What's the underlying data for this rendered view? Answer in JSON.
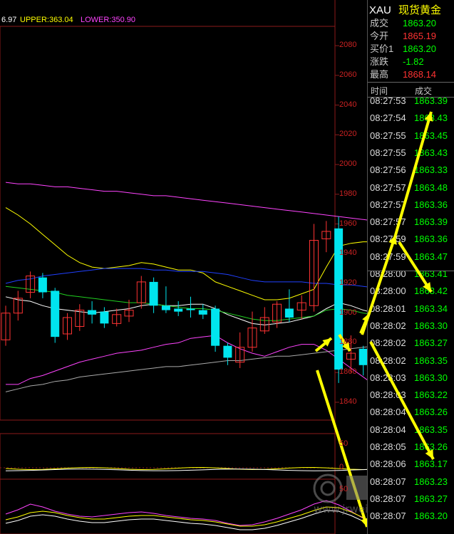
{
  "indicator": {
    "mid_label": "6.97",
    "upper_label": "UPPER:363.04",
    "lower_label": "LOWER:350.90",
    "colors": {
      "mid": "#ffffff",
      "upper": "#ffff00",
      "lower": "#ff44ff"
    }
  },
  "quote": {
    "symbol": "XAU",
    "name": "现货黄金",
    "rows": [
      {
        "label": "成交",
        "value": "1863.20",
        "color": "#00ff00"
      },
      {
        "label": "今开",
        "value": "1865.19",
        "color": "#ff3333"
      },
      {
        "label": "买价1",
        "value": "1863.20",
        "color": "#00ff00"
      },
      {
        "label": "涨跌",
        "value": "-1.82",
        "color": "#00ff00"
      },
      {
        "label": "最高",
        "value": "1868.14",
        "color": "#ff3333"
      }
    ],
    "tick_header": {
      "time": "时间",
      "price": "成交"
    },
    "ticks": [
      {
        "time": "08:27:53",
        "price": "1863.39"
      },
      {
        "time": "08:27:54",
        "price": "1863.43"
      },
      {
        "time": "08:27:55",
        "price": "1863.45"
      },
      {
        "time": "08:27:55",
        "price": "1863.43"
      },
      {
        "time": "08:27:56",
        "price": "1863.33"
      },
      {
        "time": "08:27:57",
        "price": "1863.48"
      },
      {
        "time": "08:27:57",
        "price": "1863.36"
      },
      {
        "time": "08:27:57",
        "price": "1863.39"
      },
      {
        "time": "08:27:59",
        "price": "1863.36"
      },
      {
        "time": "08:27:59",
        "price": "1863.47"
      },
      {
        "time": "08:28:00",
        "price": "1863.41"
      },
      {
        "time": "08:28:00",
        "price": "1863.42"
      },
      {
        "time": "08:28:01",
        "price": "1863.34"
      },
      {
        "time": "08:28:02",
        "price": "1863.30"
      },
      {
        "time": "08:28:02",
        "price": "1863.27"
      },
      {
        "time": "08:28:02",
        "price": "1863.35"
      },
      {
        "time": "08:28:03",
        "price": "1863.30"
      },
      {
        "time": "08:28:03",
        "price": "1863.22"
      },
      {
        "time": "08:28:04",
        "price": "1863.26"
      },
      {
        "time": "08:28:04",
        "price": "1863.35"
      },
      {
        "time": "08:28:05",
        "price": "1863.26"
      },
      {
        "time": "08:28:06",
        "price": "1863.17"
      },
      {
        "time": "08:28:07",
        "price": "1863.23"
      },
      {
        "time": "08:28:07",
        "price": "1863.27"
      },
      {
        "time": "08:28:07",
        "price": "1863.20"
      }
    ]
  },
  "chart_data": {
    "type": "candlestick",
    "y_ticks": [
      "2080",
      "2060",
      "2040",
      "2020",
      "2000",
      "1980",
      "1960",
      "1940",
      "1920",
      "1900",
      "1880",
      "1860",
      "1840"
    ],
    "ylim": [
      1828,
      2093
    ],
    "candles": [
      {
        "o": 1882,
        "c": 1900,
        "h": 1905,
        "l": 1878,
        "up": true
      },
      {
        "o": 1900,
        "c": 1910,
        "h": 1915,
        "l": 1895,
        "up": true
      },
      {
        "o": 1914,
        "c": 1925,
        "h": 1928,
        "l": 1910,
        "up": true
      },
      {
        "o": 1924,
        "c": 1914,
        "h": 1927,
        "l": 1910,
        "up": false
      },
      {
        "o": 1915,
        "c": 1884,
        "h": 1917,
        "l": 1880,
        "up": false
      },
      {
        "o": 1886,
        "c": 1897,
        "h": 1900,
        "l": 1882,
        "up": true
      },
      {
        "o": 1891,
        "c": 1902,
        "h": 1906,
        "l": 1888,
        "up": true
      },
      {
        "o": 1902,
        "c": 1899,
        "h": 1908,
        "l": 1893,
        "up": false
      },
      {
        "o": 1901,
        "c": 1893,
        "h": 1904,
        "l": 1890,
        "up": false
      },
      {
        "o": 1893,
        "c": 1899,
        "h": 1903,
        "l": 1891,
        "up": true
      },
      {
        "o": 1898,
        "c": 1902,
        "h": 1909,
        "l": 1894,
        "up": true
      },
      {
        "o": 1907,
        "c": 1921,
        "h": 1925,
        "l": 1903,
        "up": true
      },
      {
        "o": 1921,
        "c": 1905,
        "h": 1924,
        "l": 1900,
        "up": false
      },
      {
        "o": 1905,
        "c": 1902,
        "h": 1918,
        "l": 1900,
        "up": false
      },
      {
        "o": 1903,
        "c": 1901,
        "h": 1908,
        "l": 1898,
        "up": false
      },
      {
        "o": 1903,
        "c": 1902,
        "h": 1911,
        "l": 1897,
        "up": false
      },
      {
        "o": 1902,
        "c": 1899,
        "h": 1906,
        "l": 1896,
        "up": false
      },
      {
        "o": 1903,
        "c": 1878,
        "h": 1905,
        "l": 1874,
        "up": false
      },
      {
        "o": 1878,
        "c": 1870,
        "h": 1880,
        "l": 1865,
        "up": false
      },
      {
        "o": 1867,
        "c": 1877,
        "h": 1887,
        "l": 1863,
        "up": true
      },
      {
        "o": 1877,
        "c": 1890,
        "h": 1901,
        "l": 1874,
        "up": true
      },
      {
        "o": 1888,
        "c": 1897,
        "h": 1904,
        "l": 1886,
        "up": true
      },
      {
        "o": 1894,
        "c": 1906,
        "h": 1908,
        "l": 1890,
        "up": true
      },
      {
        "o": 1903,
        "c": 1897,
        "h": 1916,
        "l": 1894,
        "up": false
      },
      {
        "o": 1902,
        "c": 1907,
        "h": 1912,
        "l": 1896,
        "up": true
      },
      {
        "o": 1905,
        "c": 1949,
        "h": 1960,
        "l": 1901,
        "up": true
      },
      {
        "o": 1950,
        "c": 1955,
        "h": 1962,
        "l": 1941,
        "up": true
      },
      {
        "o": 1957,
        "c": 1862,
        "h": 1965,
        "l": 1853,
        "up": false
      },
      {
        "o": 1869,
        "c": 1873,
        "h": 1885,
        "l": 1860,
        "up": true
      },
      {
        "o": 1876,
        "c": 1865,
        "h": 1878,
        "l": 1858,
        "up": false
      },
      {
        "o": 1865,
        "c": 1863,
        "h": 1866,
        "l": 1862,
        "up": false
      }
    ],
    "lines": [
      {
        "name": "UPPER",
        "color": "#ffff00",
        "values": [
          1971,
          1966,
          1960,
          1953,
          1946,
          1939,
          1934,
          1931,
          1930,
          1931,
          1932,
          1934,
          1933,
          1931,
          1929,
          1929,
          1927,
          1921,
          1918,
          1915,
          1912,
          1909,
          1909,
          1910,
          1913,
          1916,
          1931,
          1945,
          1947,
          1948,
          1948
        ]
      },
      {
        "name": "MID",
        "color": "#ffffff",
        "values": [
          1911,
          1909,
          1908,
          1905,
          1903,
          1902,
          1901,
          1900,
          1901,
          1902,
          1903,
          1905,
          1906,
          1905,
          1905,
          1906,
          1906,
          1903,
          1899,
          1896,
          1893,
          1892,
          1893,
          1894,
          1896,
          1898,
          1903,
          1907,
          1905,
          1902,
          1900
        ]
      },
      {
        "name": "LOWER",
        "color": "#ff44ff",
        "values": [
          1852,
          1852,
          1856,
          1858,
          1861,
          1864,
          1867,
          1869,
          1871,
          1873,
          1874,
          1875,
          1877,
          1879,
          1880,
          1883,
          1884,
          1885,
          1880,
          1876,
          1873,
          1871,
          1874,
          1877,
          1879,
          1879,
          1875,
          1869,
          1863,
          1857,
          1851
        ]
      },
      {
        "name": "MA-blue",
        "color": "#2040ff",
        "values": [
          1920,
          1922,
          1923,
          1925,
          1926,
          1927,
          1928,
          1929,
          1930,
          1930,
          1930,
          1930,
          1929,
          1929,
          1928,
          1928,
          1928,
          1927,
          1926,
          1924,
          1922,
          1921,
          1921,
          1921,
          1921,
          1920,
          1920,
          1919,
          1919,
          1918,
          1917
        ]
      },
      {
        "name": "MA-green",
        "color": "#20d020",
        "values": [
          1918,
          1917,
          1916,
          1915,
          1914,
          1912,
          1911,
          1910,
          1909,
          1908,
          1907,
          1907,
          1906,
          1905,
          1904,
          1903,
          1903,
          1902,
          1900,
          1898,
          1896,
          1895,
          1895,
          1896,
          1897,
          1898,
          1902,
          1903,
          1902,
          1900,
          1899
        ]
      },
      {
        "name": "MA-magenta",
        "color": "#ff44ff",
        "values": [
          1988,
          1987,
          1987,
          1986,
          1985,
          1985,
          1984,
          1983,
          1982,
          1982,
          1981,
          1980,
          1979,
          1979,
          1978,
          1977,
          1976,
          1975,
          1974,
          1973,
          1972,
          1971,
          1970,
          1969,
          1968,
          1967,
          1966,
          1965,
          1964,
          1963,
          1962
        ]
      },
      {
        "name": "MA-gray",
        "color": "#aaaaaa",
        "values": [
          1847,
          1849,
          1851,
          1852,
          1854,
          1855,
          1857,
          1858,
          1859,
          1860,
          1861,
          1862,
          1863,
          1864,
          1864,
          1865,
          1866,
          1867,
          1868,
          1868,
          1869,
          1870,
          1871,
          1871,
          1872,
          1873,
          1874,
          1875,
          1876,
          1877,
          1878
        ]
      }
    ],
    "sub1_ticks": [
      "50",
      "0"
    ],
    "sub2_ticks": [
      "50"
    ],
    "watermark_url": "www.jrwei.com"
  }
}
